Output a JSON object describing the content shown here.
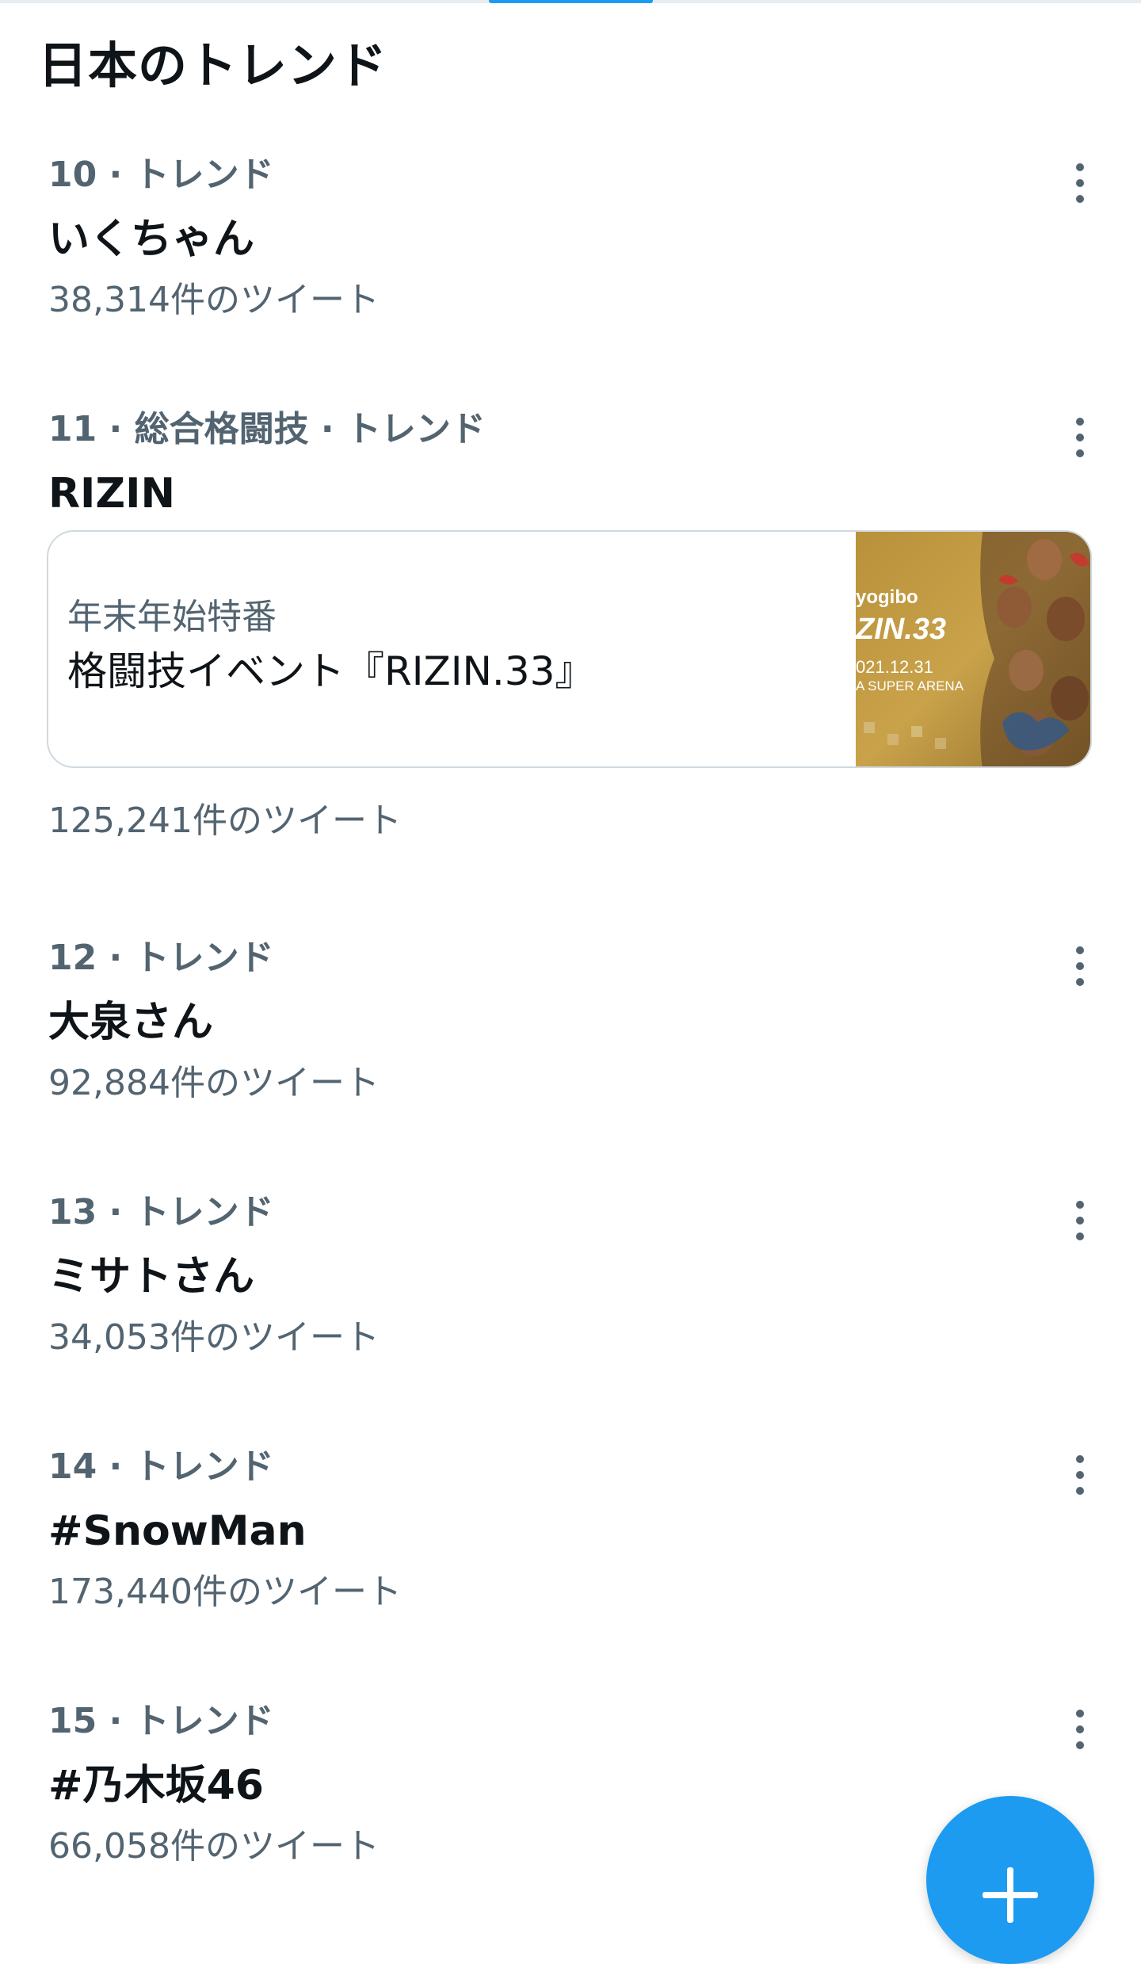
{
  "header": {
    "title": "日本のトレンド"
  },
  "trends": [
    {
      "meta": "10 · トレンド",
      "name": "いくちゃん",
      "count": "38,314件のツイート"
    },
    {
      "meta": "11 · 総合格闘技 · トレンド",
      "name": "RIZIN",
      "count": "125,241件のツイート",
      "event": {
        "subtitle": "年末年始特番",
        "title": "格闘技イベント『RIZIN.33』",
        "thumbnail": {
          "brand": "yogibo",
          "logo": "ZIN.33",
          "date": "021.12.31",
          "venue": "A SUPER ARENA"
        }
      }
    },
    {
      "meta": "12 · トレンド",
      "name": "大泉さん",
      "count": "92,884件のツイート"
    },
    {
      "meta": "13 · トレンド",
      "name": "ミサトさん",
      "count": "34,053件のツイート"
    },
    {
      "meta": "14 · トレンド",
      "name": "#SnowMan",
      "count": "173,440件のツイート"
    },
    {
      "meta": "15 · トレンド",
      "name": "#乃木坂46",
      "count": "66,058件のツイート"
    }
  ],
  "icons": {
    "more": "more-vertical-icon",
    "compose": "plus-icon"
  },
  "colors": {
    "accent": "#1d9bf0",
    "secondary_text": "#536471",
    "primary_text": "#0f1419",
    "border": "#cfd9de"
  }
}
